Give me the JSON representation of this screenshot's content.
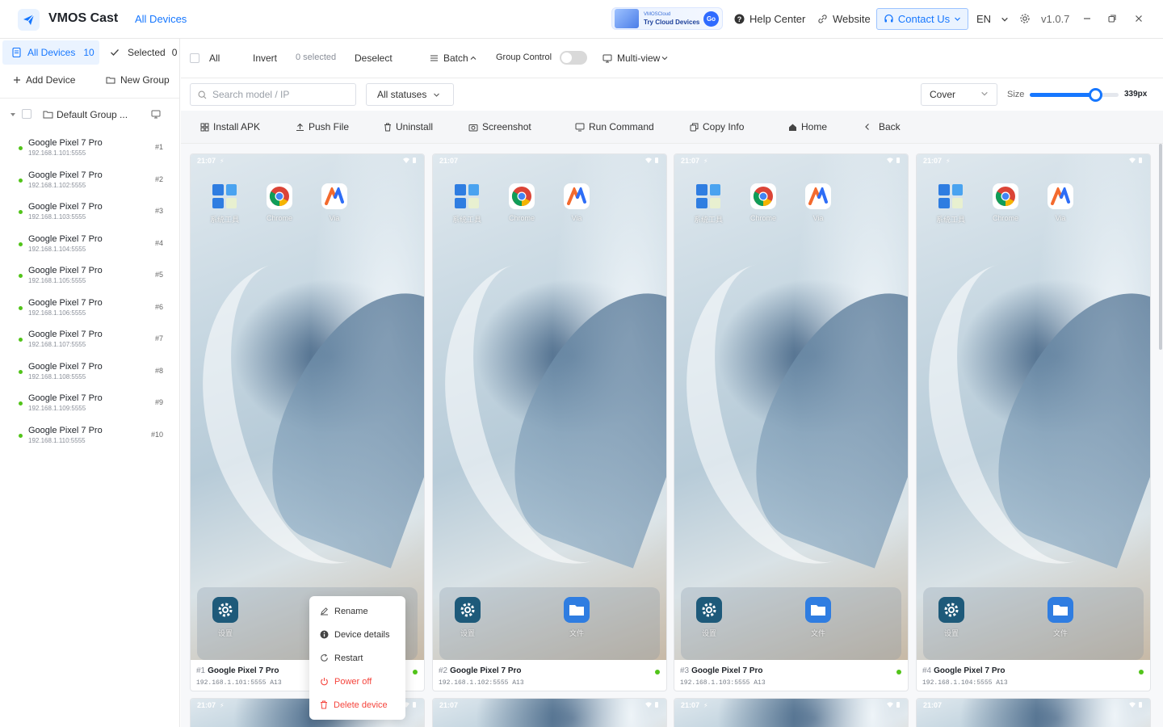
{
  "app": {
    "title": "VMOS Cast",
    "tab_all_devices": "All Devices",
    "version": "v1.0.7"
  },
  "promo": {
    "line1": "VMOSCloud",
    "line2": "Try Cloud Devices",
    "go": "Go"
  },
  "header_links": {
    "help": "Help Center",
    "website": "Website",
    "contact": "Contact Us",
    "lang": "EN"
  },
  "sidebar": {
    "tab_all": "All Devices",
    "tab_all_count": "10",
    "tab_selected": "Selected",
    "tab_selected_count": "0",
    "add_device": "Add Device",
    "new_group": "New Group",
    "group_name": "Default Group ...",
    "devices": [
      {
        "name": "Google Pixel 7 Pro",
        "ip": "192.168.1.101:5555",
        "no": "#1"
      },
      {
        "name": "Google Pixel 7 Pro",
        "ip": "192.168.1.102:5555",
        "no": "#2"
      },
      {
        "name": "Google Pixel 7 Pro",
        "ip": "192.168.1.103:5555",
        "no": "#3"
      },
      {
        "name": "Google Pixel 7 Pro",
        "ip": "192.168.1.104:5555",
        "no": "#4"
      },
      {
        "name": "Google Pixel 7 Pro",
        "ip": "192.168.1.105:5555",
        "no": "#5"
      },
      {
        "name": "Google Pixel 7 Pro",
        "ip": "192.168.1.106:5555",
        "no": "#6"
      },
      {
        "name": "Google Pixel 7 Pro",
        "ip": "192.168.1.107:5555",
        "no": "#7"
      },
      {
        "name": "Google Pixel 7 Pro",
        "ip": "192.168.1.108:5555",
        "no": "#8"
      },
      {
        "name": "Google Pixel 7 Pro",
        "ip": "192.168.1.109:5555",
        "no": "#9"
      },
      {
        "name": "Google Pixel 7 Pro",
        "ip": "192.168.1.110:5555",
        "no": "#10"
      }
    ]
  },
  "toolbar1": {
    "all": "All",
    "invert": "Invert",
    "selected": "0 selected",
    "deselect": "Deselect",
    "batch": "Batch",
    "group_control": "Group Control",
    "multi_view": "Multi-view"
  },
  "toolbar2": {
    "search_placeholder": "Search model / IP",
    "status": "All statuses",
    "cover": "Cover",
    "size_label": "Size",
    "size_value": "339px",
    "size_fraction": 0.74
  },
  "toolbar3": {
    "install_apk": "Install APK",
    "push_file": "Push File",
    "uninstall": "Uninstall",
    "screenshot": "Screenshot",
    "run_command": "Run Command",
    "copy_info": "Copy Info",
    "home": "Home",
    "back": "Back"
  },
  "phone": {
    "time": "21:07",
    "apps": [
      "系统工具",
      "Chrome",
      "Via"
    ],
    "dock_apps": [
      "设置",
      "文件"
    ]
  },
  "cards": [
    {
      "idx": "#1",
      "name": "Google Pixel 7 Pro",
      "ip": "192.168.1.101:5555 A13"
    },
    {
      "idx": "#2",
      "name": "Google Pixel 7 Pro",
      "ip": "192.168.1.102:5555 A13"
    },
    {
      "idx": "#3",
      "name": "Google Pixel 7 Pro",
      "ip": "192.168.1.103:5555 A13"
    },
    {
      "idx": "#4",
      "name": "Google Pixel 7 Pro",
      "ip": "192.168.1.104:5555 A13"
    }
  ],
  "context_menu": {
    "rename": "Rename",
    "details": "Device details",
    "restart": "Restart",
    "power_off": "Power off",
    "delete": "Delete device"
  },
  "colors": {
    "accent": "#1677ff",
    "online": "#52c41a",
    "danger": "#f5453d"
  }
}
